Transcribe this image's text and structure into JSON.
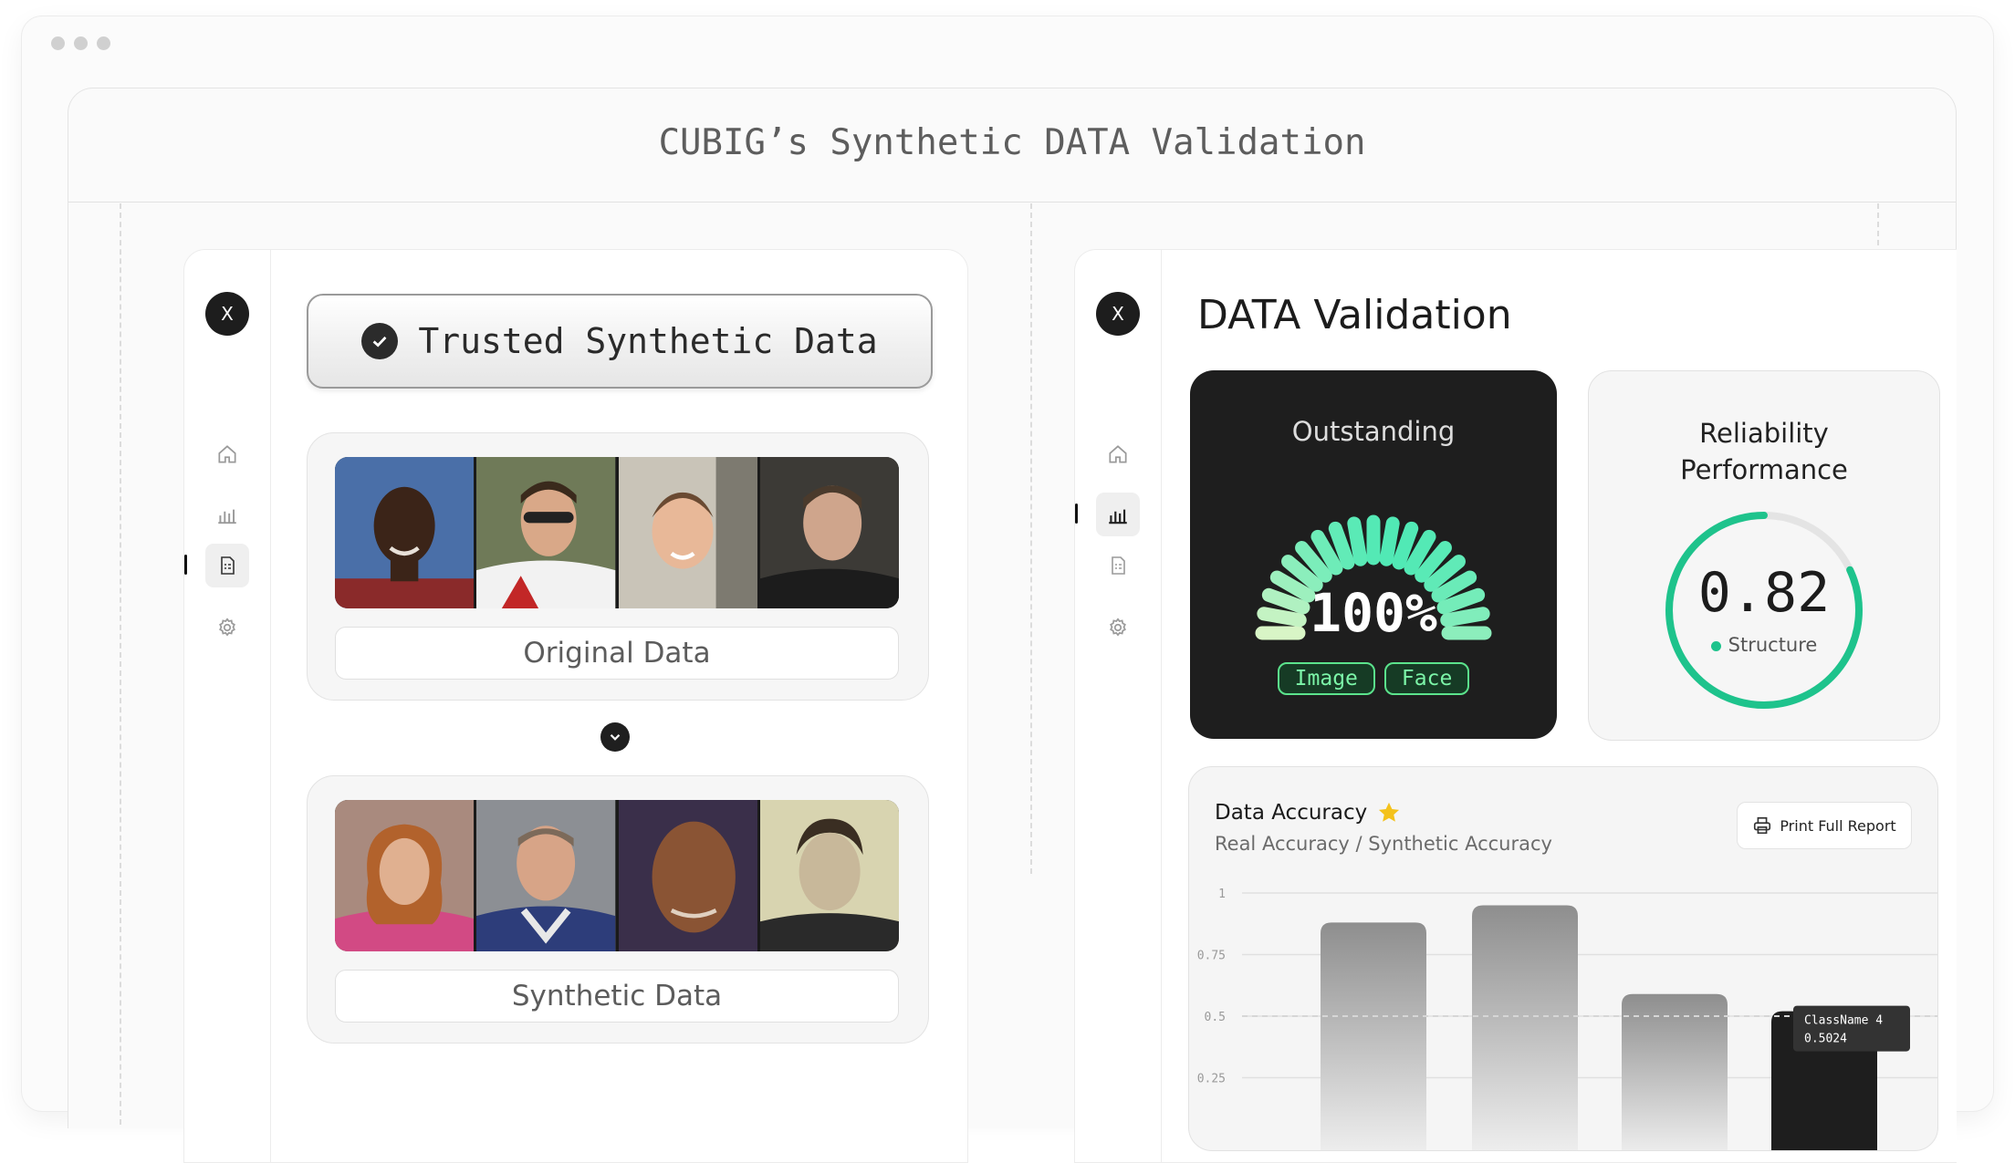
{
  "window": {
    "title": "CUBIG’s Synthetic DATA Validation"
  },
  "left_panel": {
    "close_label": "X",
    "nav": [
      "home-icon",
      "bar-chart-icon",
      "document-icon",
      "settings-icon"
    ],
    "badge": "Trusted Synthetic Data",
    "original_caption": "Original Data",
    "synthetic_caption": "Synthetic Data"
  },
  "right_panel": {
    "close_label": "X",
    "nav": [
      "home-icon",
      "bar-chart-icon",
      "document-icon",
      "settings-icon"
    ],
    "title": "DATA Validation",
    "outstanding": {
      "label": "Outstanding",
      "percent_text": "100%",
      "percent": 100,
      "tags": [
        "Image",
        "Face"
      ]
    },
    "reliability": {
      "label_line1": "Reliability",
      "label_line2": "Performance",
      "value": "0.82",
      "fraction": 0.82,
      "legend": "Structure"
    },
    "accuracy": {
      "title": "Data Accuracy",
      "subtitle": "Real Accuracy / Synthetic Accuracy",
      "print_label": "Print Full Report",
      "tooltip_name": "ClassName 4",
      "tooltip_value": "0.5024"
    }
  },
  "colors": {
    "accent_green": "#1ec38c",
    "gauge_low": "#d8f5c6",
    "gauge_high": "#2ee6b0",
    "dark": "#1e1e1e"
  },
  "chart_data": {
    "type": "bar",
    "title": "Data Accuracy",
    "subtitle": "Real Accuracy / Synthetic Accuracy",
    "ylim": [
      0,
      1
    ],
    "ytick_labels": [
      "1",
      "0.75",
      "0.5",
      "0.25"
    ],
    "ytick_values": [
      1,
      0.75,
      0.5,
      0.25
    ],
    "reference_line": 0.5,
    "values": [
      0.88,
      0.95,
      0.59,
      0.52
    ],
    "highlighted_index": 3,
    "tooltip": {
      "label": "ClassName 4",
      "value": "0.5024"
    }
  }
}
